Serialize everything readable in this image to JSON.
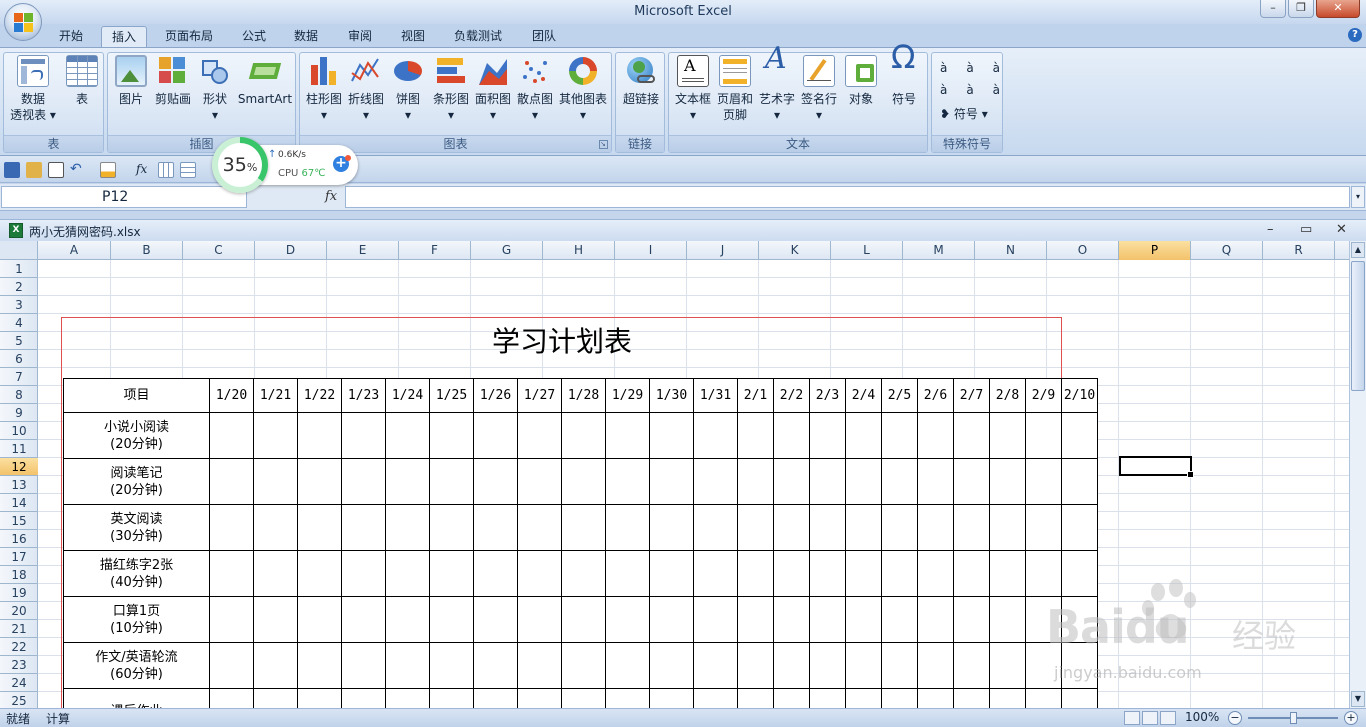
{
  "app": {
    "title": "Microsoft Excel"
  },
  "tabs": [
    {
      "label": "开始",
      "active": false
    },
    {
      "label": "插入",
      "active": true
    },
    {
      "label": "页面布局",
      "active": false
    },
    {
      "label": "公式",
      "active": false
    },
    {
      "label": "数据",
      "active": false
    },
    {
      "label": "审阅",
      "active": false
    },
    {
      "label": "视图",
      "active": false
    },
    {
      "label": "负载测试",
      "active": false
    },
    {
      "label": "团队",
      "active": false
    }
  ],
  "ribbon": {
    "groups": {
      "table": "表",
      "illustrations": "插图",
      "charts": "图表",
      "links": "链接",
      "text": "文本",
      "symbols": "特殊符号"
    },
    "buttons": {
      "pivot_line1": "数据",
      "pivot_line2": "透视表",
      "table": "表",
      "picture": "图片",
      "clipart": "剪贴画",
      "shapes": "形状",
      "smartart": "SmartArt",
      "column": "柱形图",
      "line": "折线图",
      "pie": "饼图",
      "bar": "条形图",
      "area": "面积图",
      "scatter": "散点图",
      "other": "其他图表",
      "hyperlink": "超链接",
      "textbox": "文本框",
      "header_line1": "页眉和",
      "header_line2": "页脚",
      "wordart": "艺术字",
      "signature": "签名行",
      "object": "对象",
      "symbol": "符号",
      "special_symbol": "符号",
      "accent_char": "à"
    }
  },
  "formula_bar": {
    "name_box": "P12",
    "fx": "fx",
    "value": ""
  },
  "workbook": {
    "filename": "两小无猜网密码.xlsx"
  },
  "columns": [
    "A",
    "B",
    "C",
    "D",
    "E",
    "F",
    "G",
    "H",
    "I",
    "J",
    "K",
    "L",
    "M",
    "N",
    "O",
    "P",
    "Q",
    "R"
  ],
  "rows": [
    "1",
    "2",
    "3",
    "4",
    "5",
    "6",
    "7",
    "8",
    "9",
    "10",
    "11",
    "12",
    "13",
    "14",
    "15",
    "16",
    "17",
    "18",
    "19",
    "20",
    "21",
    "22",
    "23",
    "24",
    "25"
  ],
  "selected": {
    "column": "P",
    "row": "12"
  },
  "sheet": {
    "title": "学习计划表",
    "header_label": "项目",
    "dates": [
      "1/20",
      "1/21",
      "1/22",
      "1/23",
      "1/24",
      "1/25",
      "1/26",
      "1/27",
      "1/28",
      "1/29",
      "1/30",
      "1/31",
      "2/1",
      "2/2",
      "2/3",
      "2/4",
      "2/5",
      "2/6",
      "2/7",
      "2/8",
      "2/9",
      "2/10"
    ],
    "items": [
      {
        "line1": "小说小阅读",
        "line2": "(20分钟)"
      },
      {
        "line1": "阅读笔记",
        "line2": "(20分钟)"
      },
      {
        "line1": "英文阅读",
        "line2": "(30分钟)"
      },
      {
        "line1": "描红练字2张",
        "line2": "(40分钟)"
      },
      {
        "line1": "口算1页",
        "line2": "(10分钟)"
      },
      {
        "line1": "作文/英语轮流",
        "line2": "(60分钟)"
      },
      {
        "line1": "课后作业",
        "line2": ""
      }
    ]
  },
  "status": {
    "ready": "就绪",
    "calc": "计算",
    "zoom": "100%"
  },
  "widget": {
    "percent": "35",
    "percent_sign": "%",
    "speed": "0.6K/s",
    "cpu_label": "CPU",
    "cpu_temp": "67℃",
    "progress": 0.35
  },
  "watermark": {
    "brand": "Baidu",
    "brand2": "经验",
    "url": "jingyan.baidu.com"
  }
}
